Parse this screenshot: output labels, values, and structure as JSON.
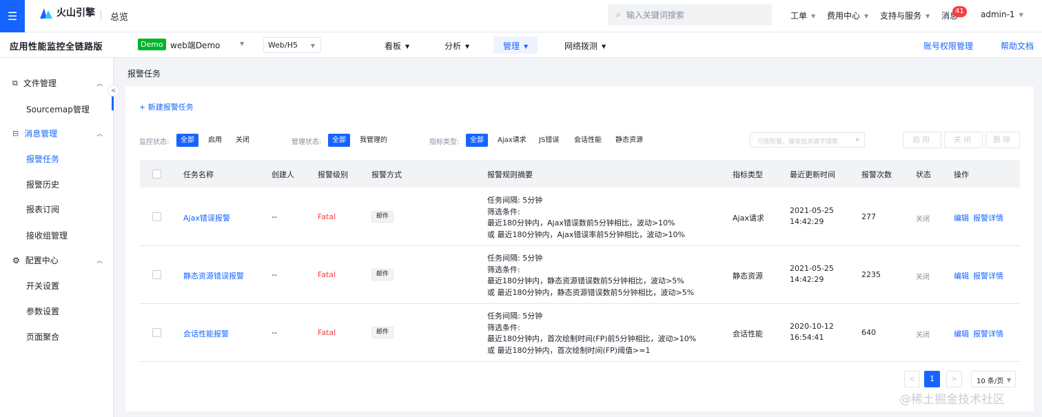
{
  "topbar": {
    "logo_text": "火山引擎",
    "overview": "总览",
    "search_placeholder": "输入关键词搜索",
    "nav": [
      "工单",
      "费用中心",
      "支持与服务",
      "消息",
      "admin-1"
    ],
    "message_badge": "41"
  },
  "subbar": {
    "app_title": "应用性能监控全链路版",
    "demo_tag": "Demo",
    "demo_name": "web端Demo",
    "platform": "Web/H5",
    "nav": [
      "看板",
      "分析",
      "管理",
      "网络拨测"
    ],
    "active_nav": "管理",
    "links": [
      "账号权限管理",
      "帮助文档"
    ]
  },
  "sidebar": {
    "groups": [
      {
        "label": "文件管理",
        "items": [
          "Sourcemap管理"
        ]
      },
      {
        "label": "消息管理",
        "items": [
          "报警任务",
          "报警历史",
          "报表订阅",
          "接收组管理"
        ]
      },
      {
        "label": "配置中心",
        "items": [
          "开关设置",
          "参数设置",
          "页面聚合"
        ]
      }
    ],
    "active_item": "报警任务"
  },
  "page": {
    "title": "报警任务",
    "new_task": "+ 新建报警任务"
  },
  "filters": {
    "monitor_label": "监控状态:",
    "monitor_options": [
      "全部",
      "启用",
      "关闭"
    ],
    "manage_label": "管理状态:",
    "manage_options": [
      "全部",
      "我管理的"
    ],
    "metric_label": "指标类型:",
    "metric_options": [
      "全部",
      "Ajax请求",
      "JS错误",
      "会话性能",
      "静态资源"
    ],
    "search_placeholder": "可按配置、接收组关键字搜索",
    "actions": [
      "启用",
      "关闭",
      "删除"
    ]
  },
  "table": {
    "headers": [
      "任务名称",
      "创建人",
      "报警级别",
      "报警方式",
      "报警规则摘要",
      "指标类型",
      "最近更新时间",
      "报警次数",
      "状态",
      "操作"
    ],
    "rows": [
      {
        "name": "Ajax错误报警",
        "creator": "--",
        "level": "Fatal",
        "method": "邮件",
        "summary": [
          "任务间隔: 5分钟",
          "筛选条件:",
          "最近180分钟内，Ajax错误数前5分钟相比，波动>10%",
          "或 最近180分钟内，Ajax错误率前5分钟相比，波动>10%"
        ],
        "metric": "Ajax请求",
        "date": "2021-05-25",
        "time": "14:42:29",
        "count": "277",
        "status": "关闭",
        "ops": [
          "编辑",
          "报警详情"
        ]
      },
      {
        "name": "静态资源错误报警",
        "creator": "--",
        "level": "Fatal",
        "method": "邮件",
        "summary": [
          "任务间隔: 5分钟",
          "筛选条件:",
          "最近180分钟内，静态资源错误数前5分钟相比，波动>5%",
          "或 最近180分钟内，静态资源错误数前5分钟相比，波动>5%"
        ],
        "metric": "静态资源",
        "date": "2021-05-25",
        "time": "14:42:29",
        "count": "2235",
        "status": "关闭",
        "ops": [
          "编辑",
          "报警详情"
        ]
      },
      {
        "name": "会话性能报警",
        "creator": "--",
        "level": "Fatal",
        "method": "邮件",
        "summary": [
          "任务间隔: 5分钟",
          "筛选条件:",
          "最近180分钟内，首次绘制时间(FP)前5分钟相比，波动>10%",
          "或 最近180分钟内，首次绘制时间(FP)阈值>=1"
        ],
        "metric": "会话性能",
        "date": "2020-10-12",
        "time": "16:54:41",
        "count": "640",
        "status": "关闭",
        "ops": [
          "编辑",
          "报警详情"
        ]
      }
    ]
  },
  "pagination": {
    "prev": "<",
    "current": "1",
    "next": ">",
    "page_size": "10 条/页"
  },
  "watermark": "@稀土掘金技术社区",
  "colors": {
    "primary": "#1664ff",
    "fatal": "#f53f3f",
    "demo_tag": "#00b42a"
  }
}
